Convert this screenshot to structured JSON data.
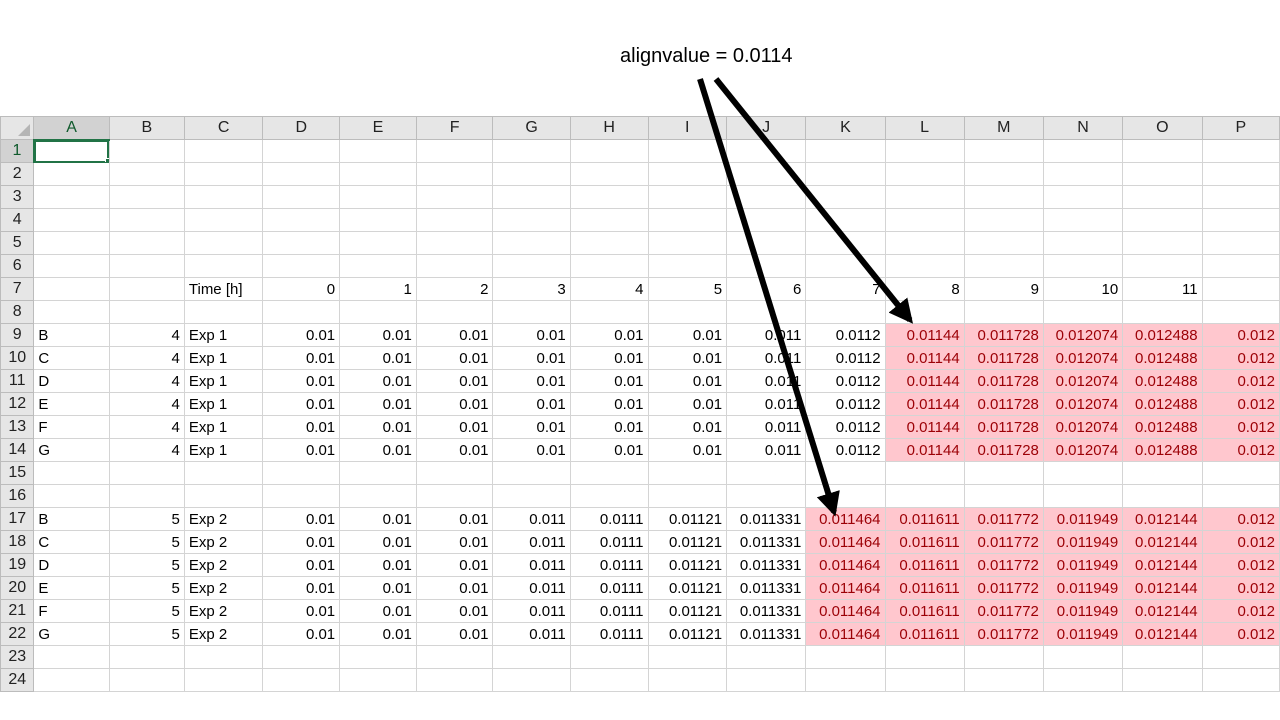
{
  "annotation": {
    "text": "alignvalue = 0.0114"
  },
  "columns": [
    "A",
    "B",
    "C",
    "D",
    "E",
    "F",
    "G",
    "H",
    "I",
    "J",
    "K",
    "L",
    "M",
    "N",
    "O",
    "P"
  ],
  "rows": [
    {
      "n": "1",
      "cells": [
        "",
        "",
        "",
        "",
        "",
        "",
        "",
        "",
        "",
        "",
        "",
        "",
        "",
        "",
        "",
        ""
      ]
    },
    {
      "n": "2",
      "cells": [
        "",
        "",
        "",
        "",
        "",
        "",
        "",
        "",
        "",
        "",
        "",
        "",
        "",
        "",
        "",
        ""
      ]
    },
    {
      "n": "3",
      "cells": [
        "",
        "",
        "",
        "",
        "",
        "",
        "",
        "",
        "",
        "",
        "",
        "",
        "",
        "",
        "",
        ""
      ]
    },
    {
      "n": "4",
      "cells": [
        "",
        "",
        "",
        "",
        "",
        "",
        "",
        "",
        "",
        "",
        "",
        "",
        "",
        "",
        "",
        ""
      ]
    },
    {
      "n": "5",
      "cells": [
        "",
        "",
        "",
        "",
        "",
        "",
        "",
        "",
        "",
        "",
        "",
        "",
        "",
        "",
        "",
        ""
      ]
    },
    {
      "n": "6",
      "cells": [
        "",
        "",
        "",
        "",
        "",
        "",
        "",
        "",
        "",
        "",
        "",
        "",
        "",
        "",
        "",
        ""
      ]
    },
    {
      "n": "7",
      "cells": [
        "",
        "",
        "Time [h]",
        "0",
        "1",
        "2",
        "3",
        "4",
        "5",
        "6",
        "7",
        "8",
        "9",
        "10",
        "11",
        ""
      ]
    },
    {
      "n": "8",
      "cells": [
        "",
        "",
        "",
        "",
        "",
        "",
        "",
        "",
        "",
        "",
        "",
        "",
        "",
        "",
        "",
        ""
      ]
    },
    {
      "n": "9",
      "cells": [
        "B",
        "4",
        "Exp 1",
        "0.01",
        "0.01",
        "0.01",
        "0.01",
        "0.01",
        "0.01",
        "0.011",
        "0.0112",
        "0.01144",
        "0.011728",
        "0.012074",
        "0.012488",
        "0.012"
      ]
    },
    {
      "n": "10",
      "cells": [
        "C",
        "4",
        "Exp 1",
        "0.01",
        "0.01",
        "0.01",
        "0.01",
        "0.01",
        "0.01",
        "0.011",
        "0.0112",
        "0.01144",
        "0.011728",
        "0.012074",
        "0.012488",
        "0.012"
      ]
    },
    {
      "n": "11",
      "cells": [
        "D",
        "4",
        "Exp 1",
        "0.01",
        "0.01",
        "0.01",
        "0.01",
        "0.01",
        "0.01",
        "0.011",
        "0.0112",
        "0.01144",
        "0.011728",
        "0.012074",
        "0.012488",
        "0.012"
      ]
    },
    {
      "n": "12",
      "cells": [
        "E",
        "4",
        "Exp 1",
        "0.01",
        "0.01",
        "0.01",
        "0.01",
        "0.01",
        "0.01",
        "0.011",
        "0.0112",
        "0.01144",
        "0.011728",
        "0.012074",
        "0.012488",
        "0.012"
      ]
    },
    {
      "n": "13",
      "cells": [
        "F",
        "4",
        "Exp 1",
        "0.01",
        "0.01",
        "0.01",
        "0.01",
        "0.01",
        "0.01",
        "0.011",
        "0.0112",
        "0.01144",
        "0.011728",
        "0.012074",
        "0.012488",
        "0.012"
      ]
    },
    {
      "n": "14",
      "cells": [
        "G",
        "4",
        "Exp 1",
        "0.01",
        "0.01",
        "0.01",
        "0.01",
        "0.01",
        "0.01",
        "0.011",
        "0.0112",
        "0.01144",
        "0.011728",
        "0.012074",
        "0.012488",
        "0.012"
      ]
    },
    {
      "n": "15",
      "cells": [
        "",
        "",
        "",
        "",
        "",
        "",
        "",
        "",
        "",
        "",
        "",
        "",
        "",
        "",
        "",
        ""
      ]
    },
    {
      "n": "16",
      "cells": [
        "",
        "",
        "",
        "",
        "",
        "",
        "",
        "",
        "",
        "",
        "",
        "",
        "",
        "",
        "",
        ""
      ]
    },
    {
      "n": "17",
      "cells": [
        "B",
        "5",
        "Exp 2",
        "0.01",
        "0.01",
        "0.01",
        "0.011",
        "0.0111",
        "0.01121",
        "0.011331",
        "0.011464",
        "0.011611",
        "0.011772",
        "0.011949",
        "0.012144",
        "0.012"
      ]
    },
    {
      "n": "18",
      "cells": [
        "C",
        "5",
        "Exp 2",
        "0.01",
        "0.01",
        "0.01",
        "0.011",
        "0.0111",
        "0.01121",
        "0.011331",
        "0.011464",
        "0.011611",
        "0.011772",
        "0.011949",
        "0.012144",
        "0.012"
      ]
    },
    {
      "n": "19",
      "cells": [
        "D",
        "5",
        "Exp 2",
        "0.01",
        "0.01",
        "0.01",
        "0.011",
        "0.0111",
        "0.01121",
        "0.011331",
        "0.011464",
        "0.011611",
        "0.011772",
        "0.011949",
        "0.012144",
        "0.012"
      ]
    },
    {
      "n": "20",
      "cells": [
        "E",
        "5",
        "Exp 2",
        "0.01",
        "0.01",
        "0.01",
        "0.011",
        "0.0111",
        "0.01121",
        "0.011331",
        "0.011464",
        "0.011611",
        "0.011772",
        "0.011949",
        "0.012144",
        "0.012"
      ]
    },
    {
      "n": "21",
      "cells": [
        "F",
        "5",
        "Exp 2",
        "0.01",
        "0.01",
        "0.01",
        "0.011",
        "0.0111",
        "0.01121",
        "0.011331",
        "0.011464",
        "0.011611",
        "0.011772",
        "0.011949",
        "0.012144",
        "0.012"
      ]
    },
    {
      "n": "22",
      "cells": [
        "G",
        "5",
        "Exp 2",
        "0.01",
        "0.01",
        "0.01",
        "0.011",
        "0.0111",
        "0.01121",
        "0.011331",
        "0.011464",
        "0.011611",
        "0.011772",
        "0.011949",
        "0.012144",
        "0.012"
      ]
    },
    {
      "n": "23",
      "cells": [
        "",
        "",
        "",
        "",
        "",
        "",
        "",
        "",
        "",
        "",
        "",
        "",
        "",
        "",
        "",
        ""
      ]
    },
    {
      "n": "24",
      "cells": [
        "",
        "",
        "",
        "",
        "",
        "",
        "",
        "",
        "",
        "",
        "",
        "",
        "",
        "",
        "",
        ""
      ]
    }
  ],
  "highlight": {
    "color_fill": "#ffc7ce",
    "color_text": "#9c0006",
    "exp1_first_col": "L",
    "exp2_first_col": "K"
  },
  "selected_cell": "A1"
}
